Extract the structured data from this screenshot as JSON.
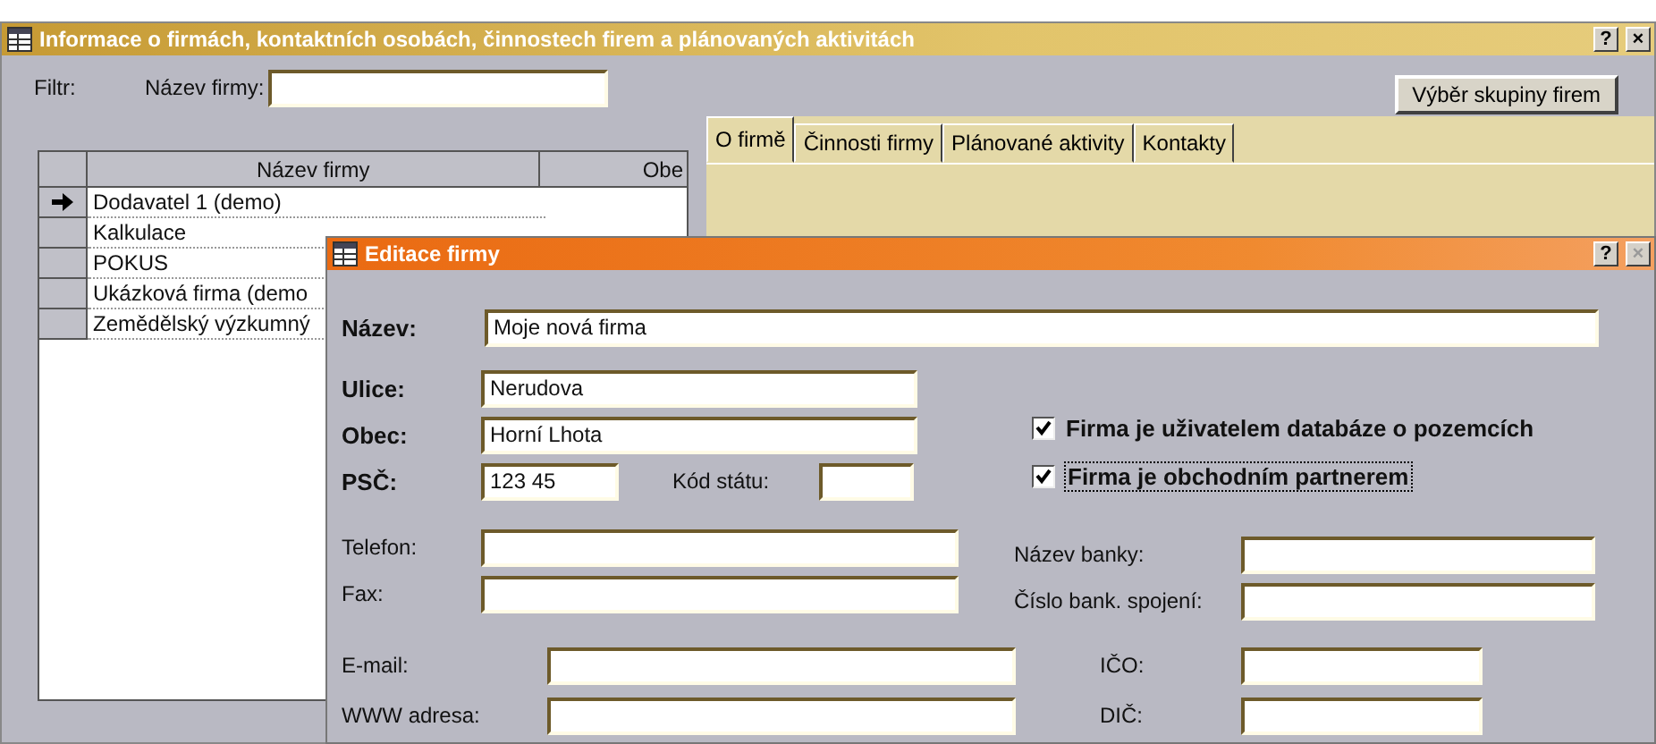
{
  "window": {
    "title": "Informace o firmách, kontaktních osobách, činnostech firem a plánovaných aktivitách",
    "help": "?",
    "close": "×"
  },
  "filter": {
    "label": "Filtr:",
    "field_label": "Název firmy:"
  },
  "group_button": "Výběr skupiny firem",
  "tabs": [
    {
      "label": "O firmě",
      "selected": true
    },
    {
      "label": "Činnosti firmy",
      "selected": false
    },
    {
      "label": "Plánované aktivity",
      "selected": false
    },
    {
      "label": "Kontakty",
      "selected": false
    }
  ],
  "grid": {
    "columns": [
      "Název firmy",
      "Obe"
    ],
    "rows": [
      {
        "name": "Dodavatel 1 (demo)",
        "current": true
      },
      {
        "name": "Kalkulace",
        "current": false
      },
      {
        "name": "POKUS",
        "current": false
      },
      {
        "name": "Ukázková firma (demo",
        "current": false
      },
      {
        "name": "Zemědělský výzkumný",
        "current": false
      }
    ]
  },
  "dialog": {
    "title": "Editace firmy",
    "help": "?",
    "close": "×",
    "close_disabled": true,
    "name": {
      "label": "Název:",
      "value": "Moje nová firma"
    },
    "street": {
      "label": "Ulice:",
      "value": "Nerudova"
    },
    "city": {
      "label": "Obec:",
      "value": "Horní Lhota"
    },
    "zip": {
      "label": "PSČ:",
      "value": "123 45"
    },
    "country_code": {
      "label": "Kód státu:"
    },
    "checkboxes": [
      {
        "label": "Firma je uživatelem databáze o pozemcích",
        "checked": true,
        "focused": false
      },
      {
        "label": "Firma je obchodním partnerem",
        "checked": true,
        "focused": true
      }
    ],
    "phone": {
      "label": "Telefon:"
    },
    "fax": {
      "label": "Fax:"
    },
    "bank_name": {
      "label": "Název banky:"
    },
    "bank_account": {
      "label": "Číslo bank. spojení:"
    },
    "email": {
      "label": "E-mail:"
    },
    "web": {
      "label": "WWW adresa:"
    },
    "ico": {
      "label": "IČO:"
    },
    "dic": {
      "label": "DIČ:"
    }
  }
}
